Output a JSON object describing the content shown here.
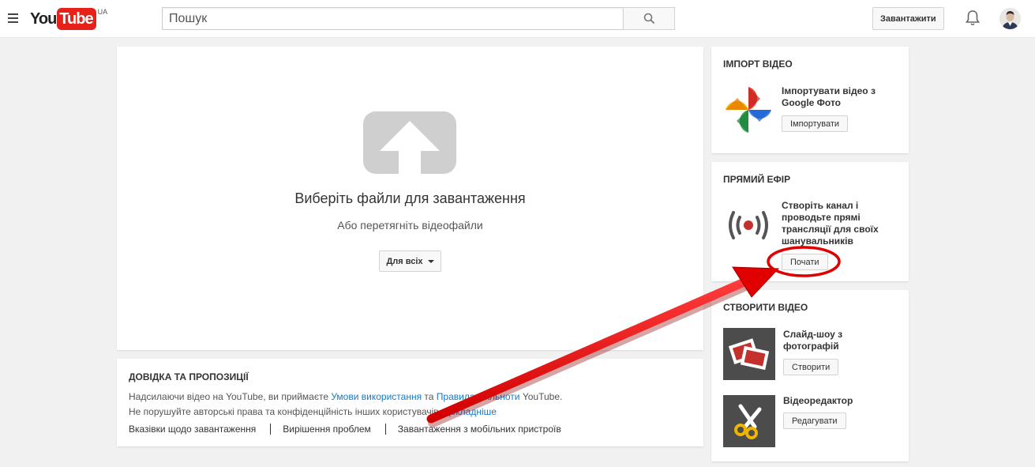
{
  "header": {
    "logo_you": "You",
    "logo_tube": "Tube",
    "logo_region": "UA",
    "search_placeholder": "Пошук",
    "upload_label": "Завантажити"
  },
  "upload": {
    "title": "Виберіть файли для завантаження",
    "subtitle": "Або перетягніть відеофайли",
    "privacy_label": "Для всіх"
  },
  "help": {
    "title": "ДОВІДКА ТА ПРОПОЗИЦІЇ",
    "line1_prefix": "Надсилаючи відео на YouTube, ви приймаєте ",
    "line1_link1": "Умови використання",
    "line1_mid": " та ",
    "line1_link2": "Правила спільноти",
    "line1_suffix": " YouTube.",
    "line2_prefix": "Не порушуйте авторські права та конфіденційність інших користувачів. ",
    "line2_link": "Докладніше",
    "links": [
      "Вказівки щодо завантаження",
      "Вирішення проблем",
      "Завантаження з мобільних пристроїв"
    ]
  },
  "import": {
    "title": "ІМПОРТ ВІДЕО",
    "text": "Імпортувати відео з Google Фото",
    "button": "Імпортувати"
  },
  "live": {
    "title": "ПРЯМИЙ ЕФІР",
    "text": "Створіть канал і проводьте прямі трансляції для своїх шанувальників",
    "button": "Почати"
  },
  "create": {
    "title": "СТВОРИТИ ВІДЕО",
    "slideshow_text": "Слайд-шоу з фотографій",
    "slideshow_button": "Створити",
    "editor_text": "Відеоредактор",
    "editor_button": "Редагувати"
  },
  "colors": {
    "brand_red": "#e62117",
    "link_blue": "#167ac6",
    "annotation_red": "#ff0000"
  }
}
